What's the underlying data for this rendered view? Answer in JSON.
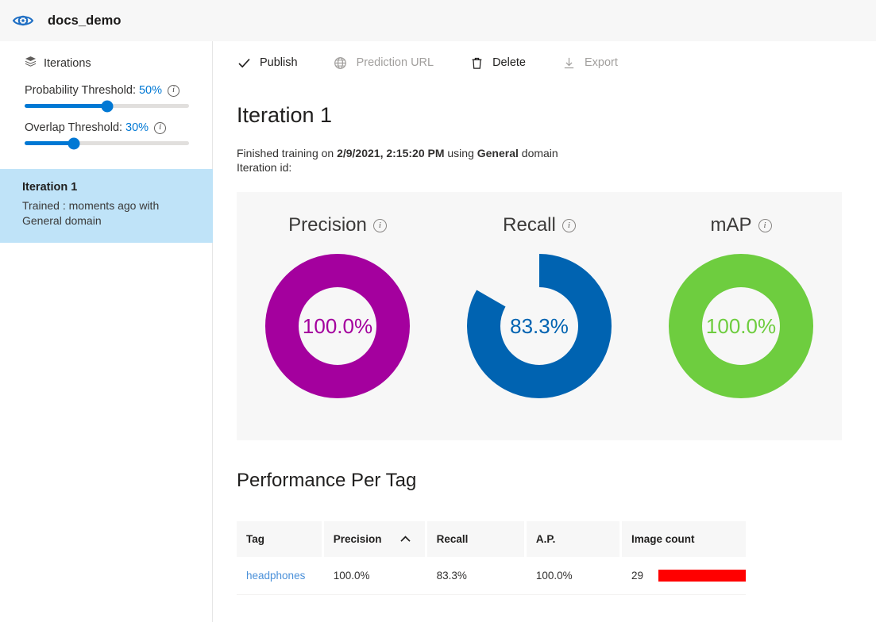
{
  "header": {
    "logo_icon": "eye-gear-icon",
    "project_title": "docs_demo"
  },
  "sidebar": {
    "section_icon": "layers-stack-icon",
    "section_label": "Iterations",
    "sliders": [
      {
        "label": "Probability Threshold:",
        "value": "50%",
        "percent": 50,
        "info_icon": "info-icon"
      },
      {
        "label": "Overlap Threshold:",
        "value": "30%",
        "percent": 30,
        "info_icon": "info-icon"
      }
    ],
    "iterations": [
      {
        "name": "Iteration 1",
        "subtitle": "Trained : moments ago with General domain",
        "selected": true
      }
    ]
  },
  "toolbar": {
    "buttons": [
      {
        "label": "Publish",
        "icon": "checkmark-icon",
        "enabled": true
      },
      {
        "label": "Prediction URL",
        "icon": "globe-icon",
        "enabled": false
      },
      {
        "label": "Delete",
        "icon": "trash-icon",
        "enabled": true
      },
      {
        "label": "Export",
        "icon": "download-icon",
        "enabled": false
      }
    ]
  },
  "main": {
    "page_title": "Iteration 1",
    "meta_prefix": "Finished training on ",
    "meta_datetime": "2/9/2021, 2:15:20 PM",
    "meta_middle": " using ",
    "meta_domain": "General",
    "meta_suffix": " domain",
    "iteration_id_label": "Iteration id:",
    "performance_title": "Performance Per Tag"
  },
  "chart_data": [
    {
      "type": "pie",
      "title": "Precision",
      "info_icon": "info-icon",
      "value_label": "100.0%",
      "value": 100.0,
      "color": "#a4009e",
      "track_color": "#f7f7f7",
      "start_angle": 0,
      "donut": true
    },
    {
      "type": "pie",
      "title": "Recall",
      "info_icon": "info-icon",
      "value_label": "83.3%",
      "value": 83.3,
      "color": "#0063b1",
      "track_color": "#f7f7f7",
      "start_angle": 0,
      "donut": true
    },
    {
      "type": "pie",
      "title": "mAP",
      "info_icon": "info-icon",
      "value_label": "100.0%",
      "value": 100.0,
      "color": "#6ecd3f",
      "track_color": "#f7f7f7",
      "start_angle": 0,
      "donut": true
    }
  ],
  "table": {
    "columns": [
      {
        "label": "Tag",
        "sorted": false
      },
      {
        "label": "Precision",
        "sorted": true,
        "sort_icon": "chevron-up-icon"
      },
      {
        "label": "Recall",
        "sorted": false
      },
      {
        "label": "A.P.",
        "sorted": false
      },
      {
        "label": "Image count",
        "sorted": false
      }
    ],
    "rows": [
      {
        "tag": "headphones",
        "precision": "100.0%",
        "recall": "83.3%",
        "ap": "100.0%",
        "image_count": "29",
        "bar_color": "#ff0000",
        "bar_percent": 100
      }
    ]
  }
}
